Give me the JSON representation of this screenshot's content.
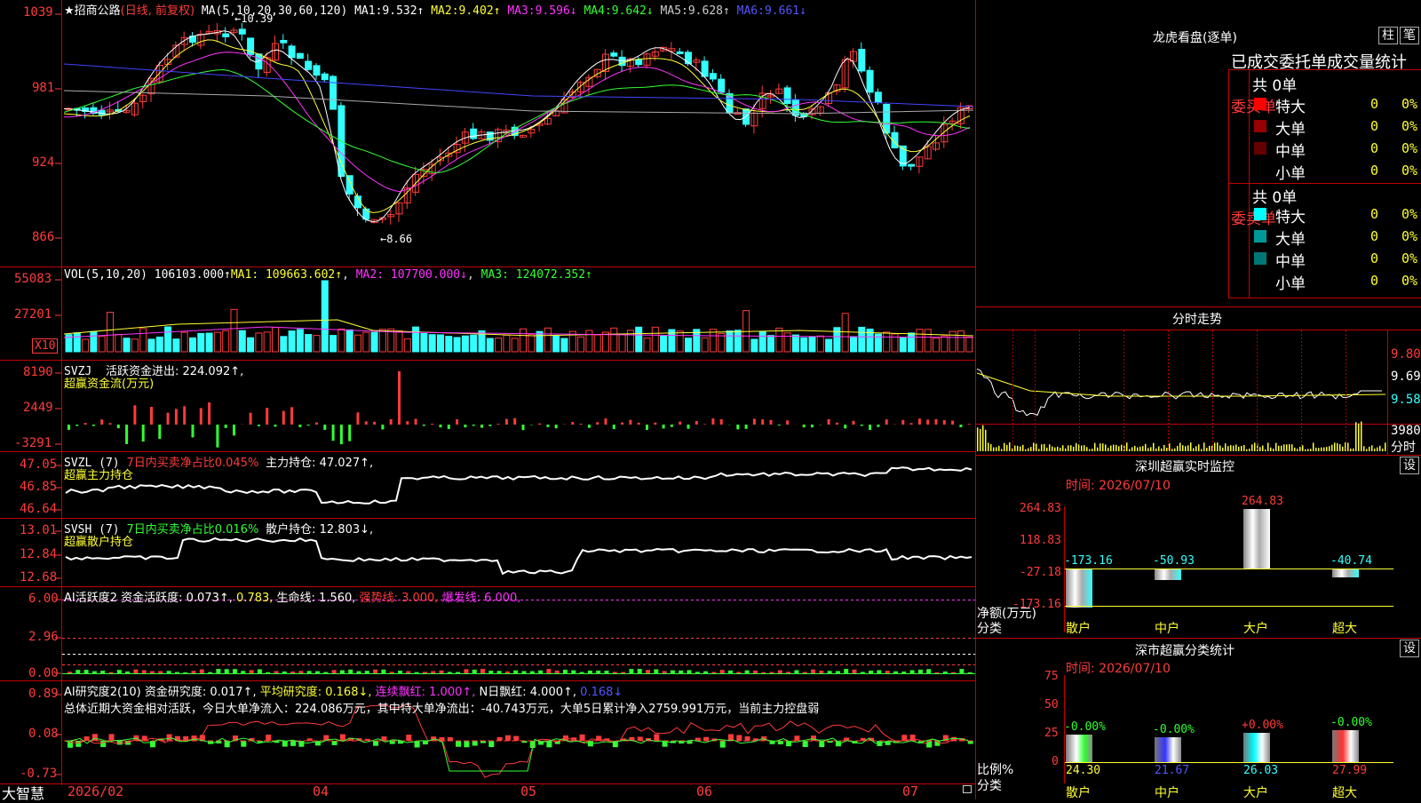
{
  "colors": {
    "up": "#ff3b3b",
    "down": "#33ffff",
    "grid": "#b00000",
    "ma1": "#ffffff",
    "ma2": "#ffff33",
    "ma3": "#ff33ff",
    "ma4": "#33ff33",
    "ma5": "#aaaaaa",
    "ma6": "#4444ff"
  },
  "bottom_left": {
    "brand": "大智慧",
    "start_date": "2026/02"
  },
  "x_months": [
    "04",
    "05",
    "06",
    "07"
  ],
  "main": {
    "title": "★招商公路",
    "mode": "(日线, 前复权)",
    "ma_label": "MA(5,10,20,30,60,120)",
    "ma": [
      {
        "name": "MA1:",
        "value": "9.532↑"
      },
      {
        "name": "MA2:",
        "value": "9.402↑"
      },
      {
        "name": "MA3:",
        "value": "9.596↓"
      },
      {
        "name": "MA4:",
        "value": "9.642↓"
      },
      {
        "name": "MA5:",
        "value": "9.628↑"
      },
      {
        "name": "MA6:",
        "value": "9.661↓"
      }
    ],
    "high_label": "←10.39",
    "low_label": "←8.66",
    "y_ticks": [
      "1039",
      "981",
      "924",
      "866"
    ]
  },
  "vol": {
    "label": "VOL(5,10,20)",
    "value": "106103.000↑",
    "ma1": "MA1: 109663.602↑",
    "ma2": "MA2: 107700.000↓",
    "ma3": "MA3: 124072.352↑",
    "y_ticks": [
      "55083",
      "27201"
    ],
    "unit": "X10"
  },
  "svzj": {
    "label": "SVZJ",
    "text": "活跃资金进出: 224.092↑,",
    "sub": "超赢资金流(万元)",
    "y_ticks": [
      "8190",
      "2449",
      "-3291"
    ]
  },
  "svzl": {
    "label": "SVZL (7)",
    "pct": "7日内买卖净占比0.045%",
    "hold": "主力持仓: 47.027↑,",
    "sub": "超赢主力持仓",
    "y_ticks": [
      "47.05",
      "46.85",
      "46.64"
    ]
  },
  "svsh": {
    "label": "SVSH (7)",
    "pct": "7日内买卖净占比0.016%",
    "hold": "散户持仓: 12.803↓,",
    "sub": "超赢散户持仓",
    "y_ticks": [
      "13.01",
      "12.84",
      "12.68"
    ]
  },
  "ai_active": {
    "label": "AI活跃度2",
    "a": "资金活跃度: 0.073↑,",
    "b": "0.783,",
    "c": "生命线: 1.560,",
    "d": "强势线: 3.000,",
    "e": "爆发线: 6.000,",
    "y_ticks": [
      "6.00",
      "2.96",
      "0.00"
    ]
  },
  "ai_research": {
    "label": "AI研究度2(10)",
    "a": "资金研究度: 0.017↑,",
    "b": "平均研究度: 0.168↓,",
    "c": "连续飘红: 1.000↑,",
    "d": "N日飘红: 4.000↑,",
    "e": "0.168↓",
    "summary": "总体近期大资金相对活跃，今日大单净流入：224.086万元，其中特大单净流出：-40.743万元，大单5日累计净入2759.991万元，当前主力控盘弱",
    "y_ticks": [
      "0.89",
      "0.08",
      "-0.73"
    ]
  },
  "dragon": {
    "title": "龙虎看盘(逐单)",
    "btn1": "柱",
    "btn2": "笔",
    "subtitle": "已成交委托单成交量统计",
    "buy_label": "委买单",
    "sell_label": "委卖单",
    "buy_total": "共 0单",
    "sell_total": "共 0单",
    "buy_rows": [
      {
        "name": "特大",
        "v": "0",
        "p": "0%",
        "c": "#ff0000"
      },
      {
        "name": "大单",
        "v": "0",
        "p": "0%",
        "c": "#990000"
      },
      {
        "name": "中单",
        "v": "0",
        "p": "0%",
        "c": "#660000"
      },
      {
        "name": "小单",
        "v": "0",
        "p": "0%",
        "c": ""
      }
    ],
    "sell_rows": [
      {
        "name": "特大",
        "v": "0",
        "p": "0%",
        "c": "#00ffff"
      },
      {
        "name": "大单",
        "v": "0",
        "p": "0%",
        "c": "#009999"
      },
      {
        "name": "中单",
        "v": "0",
        "p": "0%",
        "c": "#007777"
      },
      {
        "name": "小单",
        "v": "0",
        "p": "0%",
        "c": ""
      }
    ]
  },
  "intraday": {
    "title": "分时走势",
    "prices": [
      "9.80",
      "9.69",
      "9.58"
    ],
    "vol": "3980",
    "vol_unit": "分时"
  },
  "sz_monitor": {
    "title": "深圳超赢实时监控",
    "btn": "设",
    "time": "时间: 2026/07/10",
    "y_ticks": [
      "264.83",
      "118.83",
      "-27.18",
      "-173.16"
    ],
    "values": [
      {
        "cat": "散户",
        "v": "-173.16",
        "num": -173.16
      },
      {
        "cat": "中户",
        "v": "-50.93",
        "num": -50.93
      },
      {
        "cat": "大户",
        "v": "264.83",
        "num": 264.83
      },
      {
        "cat": "超大",
        "v": "-40.74",
        "num": -40.74
      }
    ],
    "axis_label": "净额(万元)",
    "axis_sub": "分类"
  },
  "sz_class": {
    "title": "深市超赢分类统计",
    "btn": "设",
    "time": "时间: 2026/07/10",
    "y_ticks": [
      "75",
      "50",
      "25",
      "0"
    ],
    "bars": [
      {
        "cat": "散户",
        "pct": "-0.00%",
        "val": "24.30",
        "num": 24.3,
        "c": "#ffffff",
        "c2": "#33ff33"
      },
      {
        "cat": "中户",
        "pct": "-0.00%",
        "val": "21.67",
        "num": 21.67,
        "c": "#3333ff",
        "c2": "#ffffff"
      },
      {
        "cat": "大户",
        "pct": "+0.00%",
        "val": "26.03",
        "num": 26.03,
        "c": "#00ffff",
        "c2": "#ffffff"
      },
      {
        "cat": "超大",
        "pct": "-0.00%",
        "val": "27.99",
        "num": 27.99,
        "c": "#ff3333",
        "c2": "#ffffff"
      }
    ],
    "axis_label": "比例%",
    "axis_sub": "分类"
  }
}
